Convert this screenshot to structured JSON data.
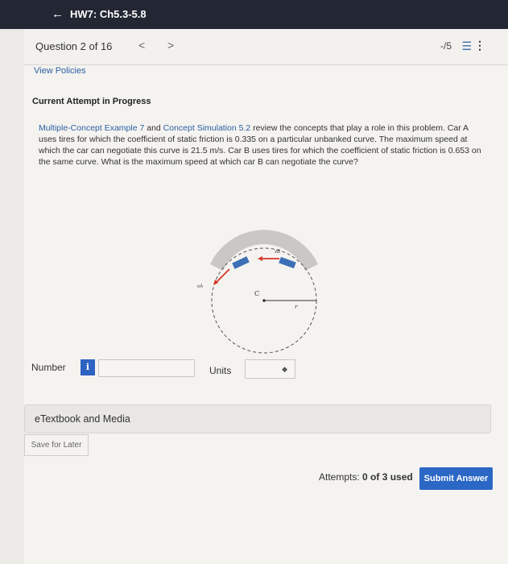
{
  "header": {
    "back_label": "HW7: Ch5.3-5.8"
  },
  "question_bar": {
    "title": "Question 2 of 16",
    "prev": "<",
    "next": ">",
    "score": "-/5",
    "list_icon": "list-icon",
    "menu_icon": "more-vertical-icon"
  },
  "view_policies": "View Policies",
  "attempt_heading": "Current Attempt in Progress",
  "problem": {
    "link1": "Multiple-Concept Example 7",
    "and": " and ",
    "link2": "Concept Simulation 5.2",
    "text": " review the concepts that play a role in this problem. Car A uses tires for which the coefficient of static friction is 0.335 on a particular unbanked curve. The maximum speed at which the car can negotiate this curve is 21.5 m/s. Car B uses tires for which the coefficient of static friction is 0.653 on the same curve. What is the maximum speed at which car B can negotiate the curve?"
  },
  "diagram": {
    "label_vb": "vB",
    "label_va": "vA",
    "label_center": "C",
    "label_r": "r"
  },
  "answer": {
    "number_label": "Number",
    "info_label": "i",
    "number_value": "",
    "units_label": "Units",
    "units_value": ""
  },
  "etextbook": "eTextbook and Media",
  "save_later": "Save for Later",
  "attempts": {
    "prefix": "Attempts: ",
    "value": "0 of 3 used"
  },
  "submit": "Submit Answer",
  "colors": {
    "accent": "#2b67c5",
    "header": "#232733",
    "car_arrow": "#d8352a"
  }
}
